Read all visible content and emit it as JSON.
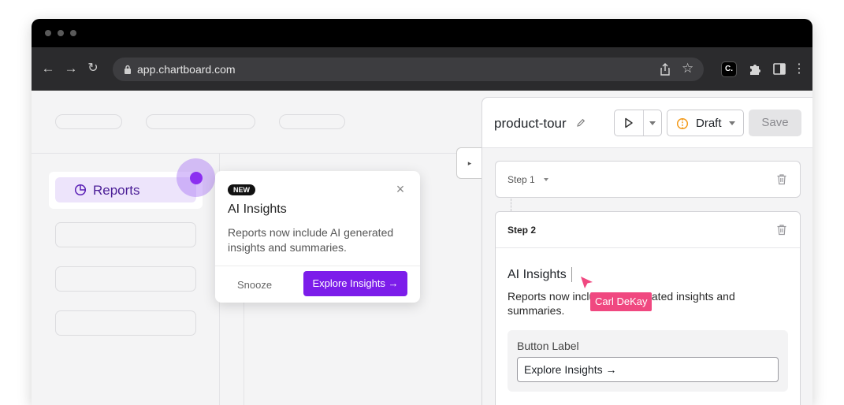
{
  "browser": {
    "url": "app.chartboard.com",
    "window_buttons": [
      "close",
      "minimize",
      "maximize"
    ],
    "nav_icons": [
      "back-icon",
      "forward-icon",
      "reload-icon"
    ],
    "toolbar_icons": [
      "share-icon",
      "bookmark-star-icon",
      "chartboard-extension-icon",
      "puzzle-extensions-icon",
      "sidebar-toggle-icon",
      "menu-dots-icon"
    ]
  },
  "sidebar": {
    "active_item": {
      "label": "Reports",
      "icon": "pie-chart-icon"
    }
  },
  "popover": {
    "badge": "NEW",
    "title": "AI Insights",
    "body": "Reports now include AI generated insights and summaries.",
    "snooze_label": "Snooze",
    "cta_label": "Explore Insights →",
    "cta_color": "#7c1dea",
    "beacon_color": "#8b2ff0"
  },
  "editor": {
    "tour_name": "product-tour",
    "status_label": "Draft",
    "save_label": "Save",
    "steps": [
      {
        "label": "Step 1"
      },
      {
        "label": "Step 2",
        "content_title": "AI Insights",
        "content_body": "Reports now include AI generated insights and summaries.",
        "button_label_heading": "Button Label",
        "button_label_value": "Explore Insights →"
      }
    ],
    "collaborator": {
      "name": "Carl DeKay",
      "color": "#f04880"
    }
  }
}
